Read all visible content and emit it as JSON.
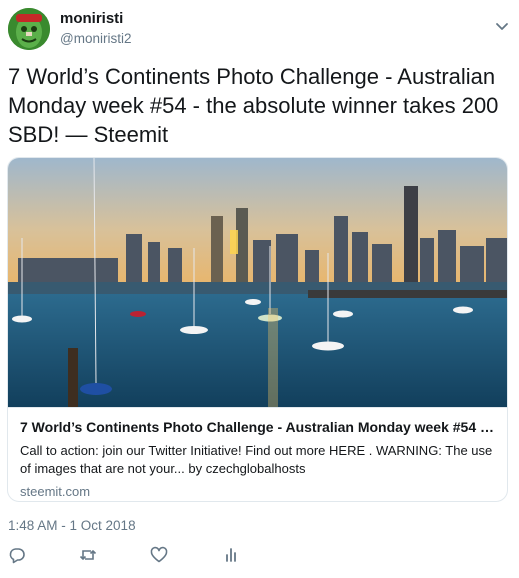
{
  "user": {
    "display_name": "moniristi",
    "handle": "@moniristi2"
  },
  "tweet": {
    "text": "7 World’s Continents Photo Challenge - Australian Monday week #54 - the absolute winner takes 200 SBD! — Steemit",
    "timestamp": "1:48 AM - 1 Oct 2018"
  },
  "card": {
    "title": "7 World’s Continents Photo Challenge - Australian Monday week #54 - th...",
    "description": "Call to action: join our Twitter Initiative! Find out more HERE . WARNING: The use of images that are not your... by czechglobalhosts",
    "domain": "steemit.com"
  },
  "actions": {
    "reply": "reply-icon",
    "retweet": "retweet-icon",
    "like": "heart-icon",
    "analytics": "analytics-icon"
  },
  "colors": {
    "text": "#14171a",
    "muted": "#657786",
    "border": "#e1e8ed",
    "icon": "#657786"
  }
}
